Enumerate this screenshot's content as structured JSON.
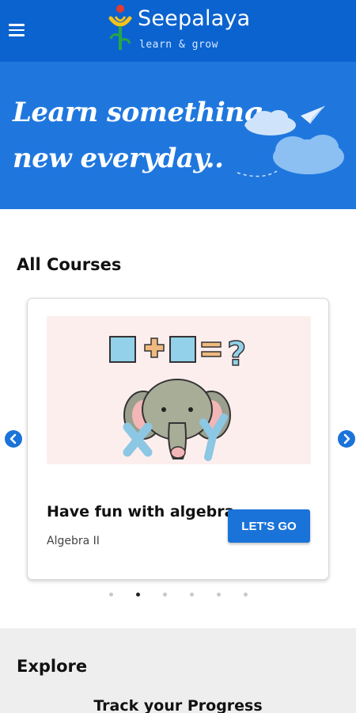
{
  "header": {
    "brand_name": "Seepalaya",
    "tagline": "learn & grow",
    "menu_icon": "hamburger-menu-icon",
    "background_color": "#0b63cf"
  },
  "hero": {
    "line1": "Learn something",
    "line2": "new everyday..",
    "background_color": "#1f77de",
    "illustration": "clouds-and-paper-plane"
  },
  "courses": {
    "section_title": "All Courses",
    "card": {
      "title": "Have fun with algebra",
      "subtitle": "Algebra II",
      "button_label": "LET'S GO",
      "illustration": "elephant-with-x-y-and-equation"
    },
    "prev_icon": "chevron-left-icon",
    "next_icon": "chevron-right-icon",
    "pagination": {
      "total": 6,
      "active_index": 1
    },
    "accent_color": "#1a73d9"
  },
  "explore": {
    "section_title": "Explore",
    "item_title": "Track your Progress"
  }
}
